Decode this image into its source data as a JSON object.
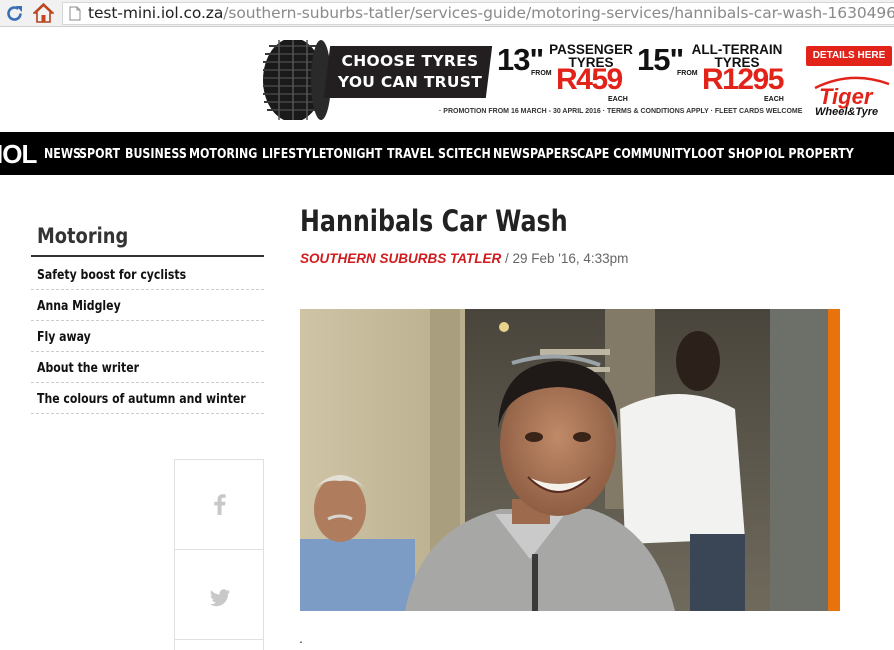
{
  "browser": {
    "url_domain": "test-mini.iol.co.za",
    "url_path": "/southern-suburbs-tatler/services-guide/motoring-services/hannibals-car-wash-1630496"
  },
  "ad": {
    "headline_line1": "CHOOSE TYRES",
    "headline_line2": "YOU CAN TRUST",
    "offer1": {
      "size": "13\"",
      "type_line1": "PASSENGER",
      "type_line2": "TYRES",
      "from": "FROM",
      "price": "R459",
      "each": "EACH"
    },
    "offer2": {
      "size": "15\"",
      "type_line1": "ALL-TERRAIN",
      "type_line2": "TYRES",
      "from": "FROM",
      "price": "R1295",
      "each": "EACH"
    },
    "promo": "· PROMOTION FROM 16 MARCH - 30 APRIL 2016 · TERMS & CONDITIONS APPLY · FLEET CARDS WELCOME",
    "cta": "DETAILS HERE",
    "brand_line1": "Tiger",
    "brand_line2": "Wheel&Tyre",
    "colors": {
      "brand_red": "#e2231a",
      "dark": "#231f20"
    }
  },
  "nav": {
    "logo": "IOL",
    "items": [
      "NEWS",
      "SPORT",
      "BUSINESS",
      "MOTORING",
      "LIFESTYLE",
      "TONIGHT",
      "TRAVEL",
      "SCITECH",
      "NEWSPAPERS",
      "CAPE COMMUNITY",
      "LOOT SHOP",
      "IOL PROPERTY"
    ]
  },
  "sidebar": {
    "heading": "Motoring",
    "items": [
      "Safety boost for cyclists",
      "Anna Midgley",
      "Fly away",
      "About the writer",
      "The colours of autumn and winter"
    ]
  },
  "share": {
    "facebook_glyph": "f",
    "icons": [
      "facebook-icon",
      "twitter-icon"
    ]
  },
  "article": {
    "title": "Hannibals Car Wash",
    "publication": "SOUTHERN SUBURBS TATLER",
    "separator": " / ",
    "date": "29 Feb '16, 4:33pm",
    "body_start": ".",
    "colors": {
      "publication": "#d01c1f"
    }
  }
}
